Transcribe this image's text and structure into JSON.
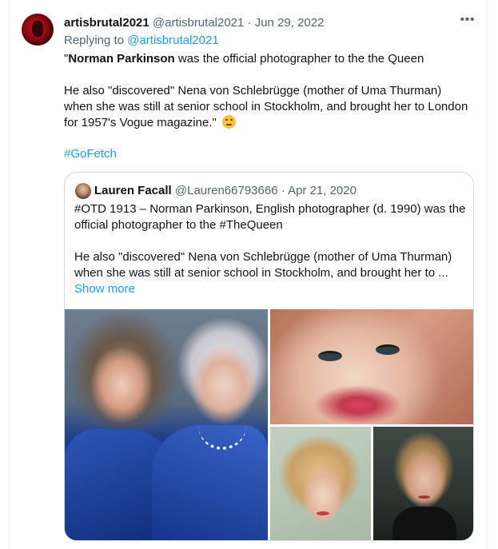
{
  "tweet": {
    "author": {
      "display_name": "artisbrutal2021",
      "handle": "@artisbrutal2021",
      "separator": "·",
      "date": "Jun 29, 2022"
    },
    "more_icon": "more-horizontal-icon",
    "reply": {
      "prefix": "Replying to",
      "handle": "@artisbrutal2021"
    },
    "text": {
      "open_quote": "\"",
      "bold": "Norman Parkinson",
      "line1_rest": " was the official photographer to the the Queen",
      "para2": "He also \"discovered\" Nena von Schlebrügge (mother of Uma Thurman) when she was still at senior school in Stockholm, and brought her to London for 1957's Vogue magazine.\"",
      "emoji": "face-with-rolling-eyes"
    },
    "hashtag": "#GoFetch"
  },
  "quoted_tweet": {
    "author": {
      "display_name": "Lauren Facall",
      "handle": "@Lauren66793666",
      "separator": "·",
      "date": "Apr 21, 2020"
    },
    "para1": "#OTD 1913 – Norman Parkinson, English photographer (d. 1990) was the official photographer to the #TheQueen",
    "para2": "He also \"discovered\" Nena von Schlebrügge (mother of Uma Thurman) when she was still at senior school in Stockholm, and brought her to ...",
    "show_more": "Show more",
    "media": [
      {
        "icon": "photo-queen-and-queen-mother"
      },
      {
        "icon": "photo-nena-closeup"
      },
      {
        "icon": "photo-blonde-portrait"
      },
      {
        "icon": "photo-uma-thurman"
      }
    ]
  },
  "colors": {
    "link": "#1d9bf0",
    "text": "#0f1419",
    "muted": "#536471",
    "border": "#cfd9de"
  }
}
